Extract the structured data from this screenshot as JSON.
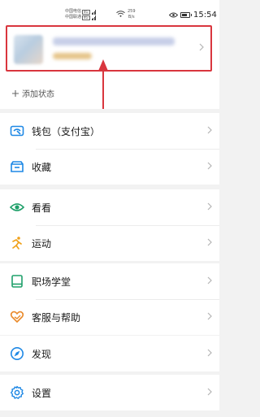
{
  "status_bar": {
    "carrier1": "中国电信",
    "carrier1_tag": "4G",
    "carrier2": "中国联通",
    "carrier2_tag": "4G",
    "speed_value": "259",
    "speed_unit": "B/s",
    "time": "15:54",
    "battery_level": 0.7
  },
  "profile": {
    "add_status_label": "添加状态"
  },
  "menu_groups": [
    [
      {
        "label": "钱包（支付宝）",
        "icon": "wallet-icon"
      },
      {
        "label": "收藏",
        "icon": "favorites-icon"
      }
    ],
    [
      {
        "label": "看看",
        "icon": "eye-icon"
      },
      {
        "label": "运动",
        "icon": "sport-icon"
      }
    ],
    [
      {
        "label": "职场学堂",
        "icon": "book-icon"
      },
      {
        "label": "客服与帮助",
        "icon": "heart-hand-icon"
      }
    ],
    [
      {
        "label": "发现",
        "icon": "compass-icon"
      }
    ],
    [
      {
        "label": "设置",
        "icon": "gear-icon"
      }
    ]
  ],
  "colors": {
    "accent_blue": "#1e88e5",
    "eye_green": "#1fa06a",
    "sport_orange": "#f0a11a",
    "help_orange": "#e98a2b",
    "highlight_red": "#d9363e"
  }
}
